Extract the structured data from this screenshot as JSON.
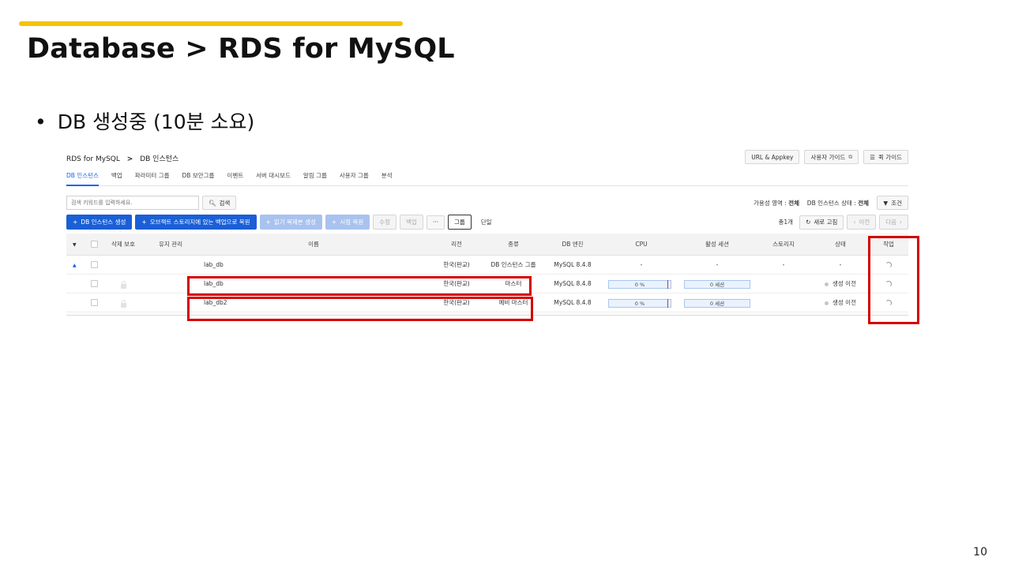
{
  "slide": {
    "title": "Database > RDS for MySQL",
    "bullet": "DB 생성중 (10분 소요)",
    "page_number": "10"
  },
  "colors": {
    "accent_bar": "#f5c400",
    "primary_button": "#1a5fd6",
    "highlight_box": "#d40000"
  },
  "console": {
    "breadcrumb": {
      "root": "RDS for MySQL",
      "separator": ">",
      "current": "DB 인스턴스"
    },
    "top_buttons": {
      "url_appkey": "URL & Appkey",
      "user_guide": "사용자 가이드",
      "quick_guide": "퀵 가이드"
    },
    "tabs": [
      "DB 인스턴스",
      "백업",
      "파라미터 그룹",
      "DB 보안그룹",
      "이벤트",
      "서버 대시보드",
      "알림 그룹",
      "사용자 그룹",
      "분석"
    ],
    "search": {
      "placeholder": "검색 키워드를 입력하세요.",
      "button": "검색"
    },
    "filter": {
      "az_label": "가용성 영역 :",
      "az_value": "전체",
      "state_label": "DB 인스턴스 상태 :",
      "state_value": "전체",
      "condition_button": "조건"
    },
    "actions": {
      "create": "DB 인스턴스 생성",
      "restore_object": "오브젝트 스토리지에 있는 백업으로 복원",
      "create_replica": "읽기 복제본 생성",
      "pitr": "시점 복원",
      "modify": "수정",
      "backup": "백업",
      "more": "···",
      "group": "그룹",
      "single": "단일"
    },
    "pager": {
      "total": "총1개",
      "refresh": "새로 고침",
      "prev": "이전",
      "next": "다음"
    },
    "table": {
      "headers": [
        "삭제 보호",
        "유지 관리",
        "이름",
        "리전",
        "종류",
        "DB 엔진",
        "CPU",
        "활성 세션",
        "스토리지",
        "상태",
        "작업"
      ],
      "rows": [
        {
          "name": "lab_db",
          "region": "한국(판교)",
          "type": "DB 인스턴스 그룹",
          "engine": "MySQL 8.4.8",
          "cpu": "-",
          "sessions": "-",
          "storage": "-",
          "status": "-",
          "group": true
        },
        {
          "name": "lab_db",
          "region": "한국(판교)",
          "type": "마스터",
          "engine": "MySQL 8.4.8",
          "cpu": "0 %",
          "sessions": "0 세션",
          "storage": "",
          "status": "생성 이전",
          "group": false
        },
        {
          "name": "lab_db2",
          "region": "한국(판교)",
          "type": "예비 마스터",
          "engine": "MySQL 8.4.8",
          "cpu": "0 %",
          "sessions": "0 세션",
          "storage": "",
          "status": "생성 이전",
          "group": false
        }
      ]
    }
  }
}
